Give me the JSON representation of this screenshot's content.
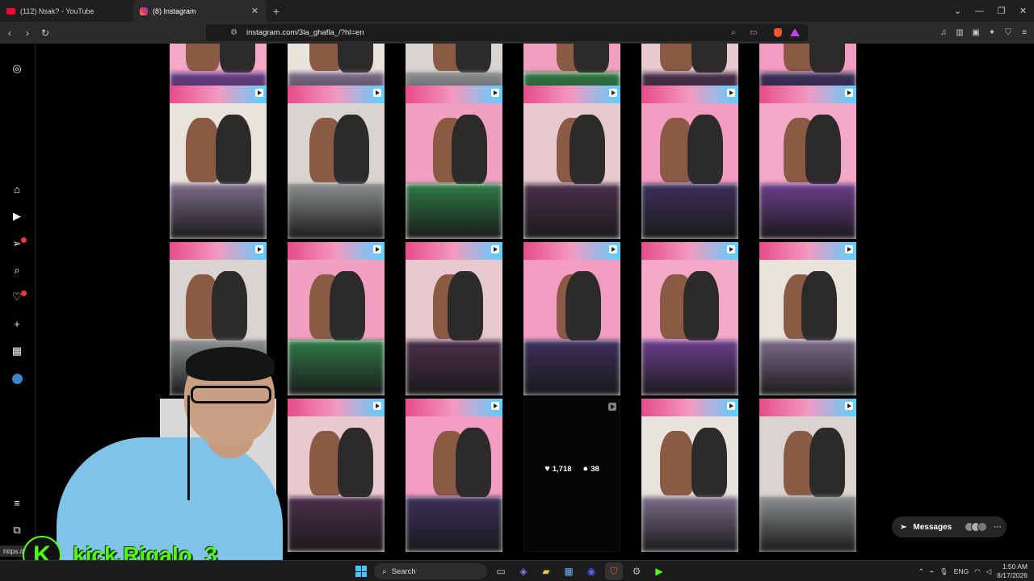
{
  "browser": {
    "tabs": [
      {
        "title": "(112) Nsak? - YouTube",
        "active": false
      },
      {
        "title": "(8) Instagram",
        "active": true
      }
    ],
    "url": "instagram.com/3la_ghafla_/?hl=en",
    "status_url": "https://w"
  },
  "rail": {
    "items": [
      "instagram-icon",
      "home-icon",
      "reels-icon",
      "messages-icon",
      "search-icon",
      "notifications-icon",
      "create-icon",
      "dashboard-icon",
      "profile-icon",
      "menu-icon",
      "more-icon"
    ]
  },
  "post": {
    "likes": "1,718",
    "comments": "38"
  },
  "messages": {
    "label": "Messages"
  },
  "stream": {
    "kick_handle": "kick.Rigalo_3"
  },
  "taskbar": {
    "search_placeholder": "Search",
    "language": "ENG",
    "time": "1:50 AM",
    "date": "8/17/2026"
  },
  "colors": {
    "kick_green": "#53fc18",
    "ig_badge": "#ff3040",
    "room_pink": "#f4a9c8"
  }
}
